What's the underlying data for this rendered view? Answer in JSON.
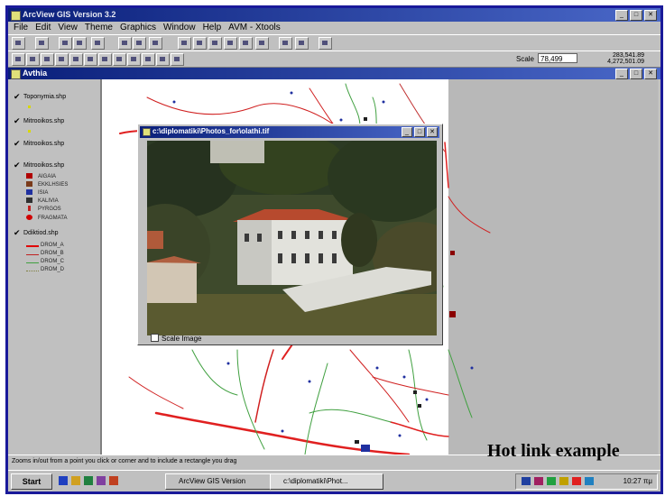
{
  "window": {
    "title": "ArcView GIS Version 3.2"
  },
  "menu": [
    "File",
    "Edit",
    "View",
    "Theme",
    "Graphics",
    "Window",
    "Help",
    "AVM - Xtools"
  ],
  "toolbar": {
    "scale_label": "Scale",
    "scale_value": "78,499",
    "coords": [
      "283,541.89",
      "4,272,501.09"
    ]
  },
  "view": {
    "title": "Avthia"
  },
  "toc": [
    {
      "label": "Toponymia.shp"
    },
    {
      "label": "Mitrooikos.shp"
    },
    {
      "label": "Mitrooikos.shp"
    },
    {
      "label": "Mitrooikos.shp",
      "symbols": [
        "AIGAIA",
        "EKKLHSIES",
        "ISIA",
        "KALIVIA",
        "PYRGOS",
        "FRAGMATA"
      ]
    },
    {
      "label": "Ddiktiod.shp",
      "symbols": [
        "DROM_A",
        "DROM_B",
        "DROM_C",
        "DROM_D"
      ]
    }
  ],
  "popup": {
    "title": "c:\\diplomatiki\\Photos_for\\olathi.tif",
    "scale_image": "Scale Image"
  },
  "status": "Zooms in/out from a point you click or corner and to include a rectangle you drag",
  "taskbar": {
    "start": "Start",
    "tasks": [
      "ArcView GIS Version",
      "c:\\diplomatiki\\Phot..."
    ],
    "clock": "10:27 πμ"
  },
  "caption": "Hot link example"
}
